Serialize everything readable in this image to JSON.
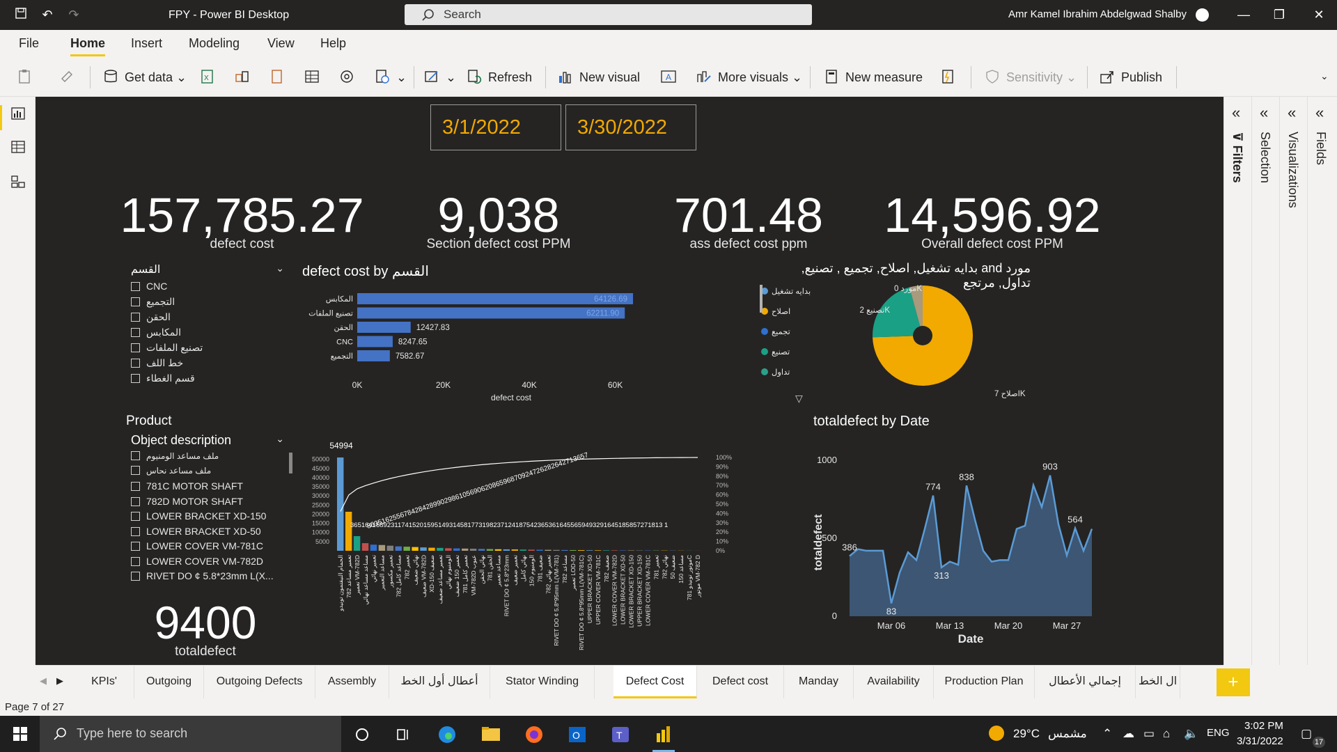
{
  "window": {
    "title": "FPY - Power BI Desktop",
    "search_label": "Search",
    "user_name": "Amr Kamel Ibrahim Abdelgwad Shalby"
  },
  "menu": {
    "items": [
      "File",
      "Home",
      "Insert",
      "Modeling",
      "View",
      "Help"
    ],
    "active": "Home"
  },
  "ribbon": {
    "get_data": "Get data",
    "refresh": "Refresh",
    "new_visual": "New visual",
    "more_visuals": "More visuals",
    "new_measure": "New measure",
    "sensitivity": "Sensitivity",
    "publish": "Publish"
  },
  "report": {
    "date_start": "3/1/2022",
    "date_end": "3/30/2022",
    "kpis": [
      {
        "value": "157,785.27",
        "label": "defect cost"
      },
      {
        "value": "9,038",
        "label": "Section defect cost PPM"
      },
      {
        "value": "701.48",
        "label": "ass defect cost ppm"
      },
      {
        "value": "14,596.92",
        "label": "Overall defect cost PPM"
      }
    ],
    "total_defect": {
      "value": "9400",
      "label": "totaldefect"
    },
    "section_slicer": {
      "title": "القسم",
      "items": [
        "CNC",
        "التجميع",
        "الحقن",
        "المكابس",
        "تصنيع الملفات",
        "خط اللف",
        "قسم الغطاء"
      ]
    },
    "product_slicer": {
      "heading": "Product",
      "title": "Object description",
      "items": [
        "ملف مساعد الومنيوم",
        "ملف مساعد نحاس",
        "781C MOTOR SHAFT",
        "782D MOTOR SHAFT",
        "LOWER BRACKET XD-150",
        "LOWER BRACKET XD-50",
        "LOWER COVER VM-781C",
        "LOWER COVER VM-782D",
        "RIVET DO ¢ 5.8*23mm L(X..."
      ]
    },
    "pareto_top_label": "54994",
    "pareto_scroll_text": "8635162556784284289902986105690620865968709247262826427136576825461526959974845982890389999699999999999999999999999%",
    "pareto_data_labels": "3651641589231174152015951493145817731982371241875423653616455659493291645185857271813 1",
    "pareto_categories": [
      "الحمام النيفتمون تونيدو",
      "782 تعمير مساعد",
      "تعمير VM-782D",
      "مساعد مساعد نهائي",
      "تعمير نهائي",
      "مساعد التعمير",
      "تعمير مكسور",
      "782 مساعد كامل",
      "تعمير 782",
      "نهائي ضعيف",
      "ضعيف VM-782D",
      "XD-150 ضعيف",
      "تعمير مساعد ضعيف",
      "الومنيوم نهائي",
      "تعمير 150 ضعيف",
      "781 تعمير كامل",
      "VM-782D عيوب",
      "نهائي الحقن",
      "الحقن 781",
      "مساعد تعمير",
      "RIVET DO ¢ 5.8*23mm",
      "تعمير ضعيف",
      "نهائي كامل",
      "الومنيوم 150",
      "781 ضعيف",
      "تعمير نهائي 782",
      "RIVET DO ¢ 5.8*95mm L(VM-781)",
      "مساعد 782",
      "تعمير LOD-50",
      "RIVET DO ¢ 5.8*95mm L(VM-781C)",
      "UPPER BRACKET XD-50",
      "UPPER COVER VM-781C",
      "782 ضعيف",
      "LOWER COVER VM-782D",
      "LOWER BRACKET XD-50",
      "LOWER BRACKET XD-150",
      "UPPER BRACKET XD-150",
      "LOWER COVER VM-781C",
      "781 تعمير",
      "نهائي 782",
      "ضعيف 50",
      "مساعد 150",
      "موتور تونيدو 781C",
      "موتور VM-782 D"
    ],
    "bar_chart_title_en": "defect cost by ",
    "bar_chart_title_ar": "القسم",
    "pie_title": "مورد and بدايه تشغيل, اصلاح, تجميع , تصنيع, تداول, مرتجع",
    "line_title": "totaldefect by Date"
  },
  "chart_data": [
    {
      "type": "bar",
      "title": "defect cost by القسم",
      "categories": [
        "المكابس",
        "تصنيع الملفات",
        "الحقن",
        "CNC",
        "التجميع"
      ],
      "values": [
        64126.69,
        62211.9,
        12427.83,
        8247.65,
        7582.67
      ],
      "value_labels": [
        "64126.69",
        "62211.90",
        "12427.83",
        "8247.65",
        "7582.67"
      ],
      "xlabel": "defect cost",
      "xticks": [
        "0K",
        "20K",
        "40K",
        "60K"
      ],
      "xlim": [
        0,
        70000
      ],
      "color": "#4472c4"
    },
    {
      "type": "pie",
      "title": "مورد and بدايه تشغيل, اصلاح, تجميع , تصنيع, تداول, مرتجع",
      "legend": [
        {
          "name": "بدايه تشغيل",
          "color": "#5b9bd5"
        },
        {
          "name": "اصلاح",
          "color": "#f2a900"
        },
        {
          "name": "تجميع",
          "color": "#2f6fd0"
        },
        {
          "name": "تصنيع",
          "color": "#1aa085"
        },
        {
          "name": "تداول",
          "color": "#2aa08a"
        }
      ],
      "slices": [
        {
          "name": "اصلاح",
          "value": 7000,
          "label": "اصلاح 7K",
          "color": "#f2a900"
        },
        {
          "name": "تصنيع",
          "value": 2000,
          "label": "تصنيع 2K",
          "color": "#1aa085"
        },
        {
          "name": "مورد",
          "value": 400,
          "label": "مورد 0K",
          "color": "#a89a7c"
        }
      ]
    },
    {
      "type": "area",
      "title": "totaldefect by Date",
      "xlabel": "Date",
      "ylabel": "totaldefect",
      "yticks": [
        "0",
        "500",
        "1000"
      ],
      "ylim": [
        0,
        1000
      ],
      "xticks": [
        "Mar 06",
        "Mar 13",
        "Mar 20",
        "Mar 27"
      ],
      "x": [
        "2022-03-01",
        "2022-03-02",
        "2022-03-03",
        "2022-03-04",
        "2022-03-05",
        "2022-03-06",
        "2022-03-07",
        "2022-03-08",
        "2022-03-09",
        "2022-03-10",
        "2022-03-11",
        "2022-03-12",
        "2022-03-13",
        "2022-03-14",
        "2022-03-15",
        "2022-03-16",
        "2022-03-17",
        "2022-03-18",
        "2022-03-19",
        "2022-03-20",
        "2022-03-21",
        "2022-03-22",
        "2022-03-23",
        "2022-03-24",
        "2022-03-25",
        "2022-03-26",
        "2022-03-27",
        "2022-03-28",
        "2022-03-29",
        "2022-03-30"
      ],
      "values": [
        386,
        430,
        420,
        420,
        420,
        83,
        280,
        410,
        360,
        560,
        774,
        313,
        350,
        330,
        838,
        620,
        420,
        350,
        360,
        360,
        560,
        580,
        840,
        700,
        903,
        590,
        390,
        564,
        420,
        560
      ],
      "labels": [
        {
          "x": "2022-03-01",
          "text": "386"
        },
        {
          "x": "2022-03-06",
          "text": "83"
        },
        {
          "x": "2022-03-11",
          "text": "774"
        },
        {
          "x": "2022-03-12",
          "text": "313"
        },
        {
          "x": "2022-03-15",
          "text": "838"
        },
        {
          "x": "2022-03-25",
          "text": "903"
        },
        {
          "x": "2022-03-28",
          "text": "564"
        }
      ],
      "color": "#5b9bd5"
    },
    {
      "type": "bar",
      "title": "Pareto",
      "yticks_left": [
        "5000",
        "10000",
        "15000",
        "20000",
        "25000",
        "30000",
        "35000",
        "40000",
        "45000",
        "50000"
      ],
      "yticks_right": [
        "0%",
        "10%",
        "20%",
        "30%",
        "40%",
        "50%",
        "60%",
        "70%",
        "80%",
        "90%",
        "100%"
      ],
      "values": [
        54994,
        23000,
        8635,
        4500,
        3600,
        3400,
        3000,
        2600,
        2400,
        2200,
        2000,
        1800,
        1700,
        1500,
        1400,
        1300,
        1200,
        1100,
        1000,
        900,
        850,
        800,
        700,
        650,
        600,
        550,
        500,
        450,
        400,
        350,
        300,
        280,
        260,
        240,
        220,
        200,
        180,
        160,
        140,
        120,
        100,
        80,
        60,
        40
      ],
      "ylim": [
        0,
        55000
      ]
    }
  ],
  "tabs": {
    "items": [
      "KPIs'",
      "Outgoing",
      "Outgoing Defects",
      "Assembly",
      "أعطال أول الخط",
      "Stator Winding",
      "Defect Cost",
      "Defect cost",
      "Manday",
      "Availability",
      "Production Plan",
      "إجمالي الأعطال",
      "ال الخط"
    ],
    "active": "Defect Cost",
    "add_label": "+"
  },
  "status": {
    "page": "Page 7 of 27"
  },
  "taskbar": {
    "search": "Type here to search",
    "weather": "29°C",
    "weather_ar": "مشمس",
    "lang": "ENG",
    "time": "3:02 PM",
    "date": "3/31/2022",
    "notif": "17"
  }
}
